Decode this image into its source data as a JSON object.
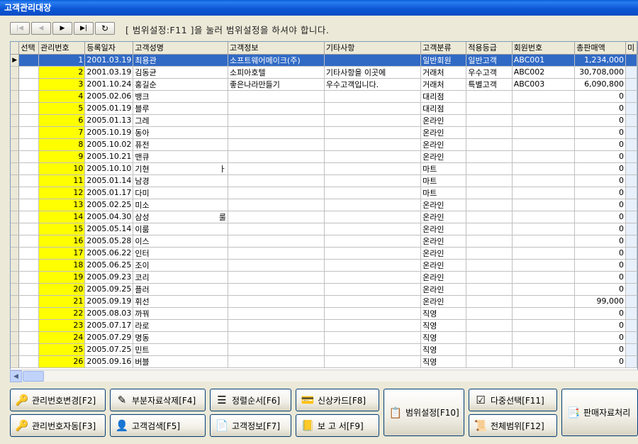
{
  "window": {
    "title": "고객관리대장"
  },
  "nav": {
    "first_icon": "first-record-icon",
    "prev_icon": "prev-record-icon",
    "next_icon": "next-record-icon",
    "last_icon": "last-record-icon",
    "refresh_icon": "refresh-icon",
    "hint": "[ 범위설정:F11 ]을 눌러 범위설정을 하셔야 합니다."
  },
  "grid": {
    "columns": [
      "선택",
      "관리번호",
      "등록일자",
      "고객성명",
      "고객정보",
      "기타사항",
      "고객분류",
      "적용등급",
      "회원번호",
      "총판매액",
      "미"
    ],
    "rows": [
      {
        "no": "1",
        "date": "2001.03.19",
        "name": "최용관",
        "info": "소프트웨어메이크(주)",
        "etc": "",
        "cat": "일반회원",
        "grade": "일반고객",
        "member": "ABC001",
        "total": "1,234,000"
      },
      {
        "no": "2",
        "date": "2001.03.19",
        "name": "김동균",
        "info": "소피아호텔",
        "etc": "기타사항을 이곳에",
        "cat": "거래처",
        "grade": "우수고객",
        "member": "ABC002",
        "total": "30,708,000"
      },
      {
        "no": "3",
        "date": "2001.10.24",
        "name": "홍길순",
        "info": "좋은나라만들기",
        "etc": "우수고객입니다.",
        "cat": "거래처",
        "grade": "특별고객",
        "member": "ABC003",
        "total": "6,090,800"
      },
      {
        "no": "4",
        "date": "2005.02.06",
        "name": "뱅크",
        "info": "",
        "etc": "",
        "cat": "대리점",
        "grade": "",
        "member": "",
        "total": "0"
      },
      {
        "no": "5",
        "date": "2005.01.19",
        "name": "블루",
        "info": "",
        "etc": "",
        "cat": "대리점",
        "grade": "",
        "member": "",
        "total": "0"
      },
      {
        "no": "6",
        "date": "2005.01.13",
        "name": "그레",
        "info": "",
        "etc": "",
        "cat": "온라인",
        "grade": "",
        "member": "",
        "total": "0"
      },
      {
        "no": "7",
        "date": "2005.10.19",
        "name": "동아",
        "info": "",
        "etc": "",
        "cat": "온라인",
        "grade": "",
        "member": "",
        "total": "0"
      },
      {
        "no": "8",
        "date": "2005.10.02",
        "name": "퓨전",
        "info": "",
        "etc": "",
        "cat": "온라인",
        "grade": "",
        "member": "",
        "total": "0"
      },
      {
        "no": "9",
        "date": "2005.10.21",
        "name": "맨큐",
        "info": "",
        "etc": "",
        "cat": "온라인",
        "grade": "",
        "member": "",
        "total": "0"
      },
      {
        "no": "10",
        "date": "2005.10.10",
        "name": "기현",
        "info": "",
        "etc": "",
        "cat": "마트",
        "grade": "",
        "member": "",
        "total": "0"
      },
      {
        "no": "11",
        "date": "2005.01.14",
        "name": "남경",
        "info": "",
        "etc": "",
        "cat": "마트",
        "grade": "",
        "member": "",
        "total": "0"
      },
      {
        "no": "12",
        "date": "2005.01.17",
        "name": "다미",
        "info": "",
        "etc": "",
        "cat": "마트",
        "grade": "",
        "member": "",
        "total": "0"
      },
      {
        "no": "13",
        "date": "2005.02.25",
        "name": "미소",
        "info": "",
        "etc": "",
        "cat": "온라인",
        "grade": "",
        "member": "",
        "total": "0"
      },
      {
        "no": "14",
        "date": "2005.04.30",
        "name": "삼성",
        "info": "",
        "etc": "",
        "cat": "온라인",
        "grade": "",
        "member": "",
        "total": "0"
      },
      {
        "no": "15",
        "date": "2005.05.14",
        "name": "이룸",
        "info": "",
        "etc": "",
        "cat": "온라인",
        "grade": "",
        "member": "",
        "total": "0"
      },
      {
        "no": "16",
        "date": "2005.05.28",
        "name": "이스",
        "info": "",
        "etc": "",
        "cat": "온라인",
        "grade": "",
        "member": "",
        "total": "0"
      },
      {
        "no": "17",
        "date": "2005.06.22",
        "name": "인터",
        "info": "",
        "etc": "",
        "cat": "온라인",
        "grade": "",
        "member": "",
        "total": "0"
      },
      {
        "no": "18",
        "date": "2005.06.25",
        "name": "조이",
        "info": "",
        "etc": "",
        "cat": "온라인",
        "grade": "",
        "member": "",
        "total": "0"
      },
      {
        "no": "19",
        "date": "2005.09.23",
        "name": "코리",
        "info": "",
        "etc": "",
        "cat": "온라인",
        "grade": "",
        "member": "",
        "total": "0"
      },
      {
        "no": "20",
        "date": "2005.09.25",
        "name": "플러",
        "info": "",
        "etc": "",
        "cat": "온라인",
        "grade": "",
        "member": "",
        "total": "0"
      },
      {
        "no": "21",
        "date": "2005.09.19",
        "name": "휘선",
        "info": "",
        "etc": "",
        "cat": "온라인",
        "grade": "",
        "member": "",
        "total": "99,000"
      },
      {
        "no": "22",
        "date": "2005.08.03",
        "name": "까꿔",
        "info": "",
        "etc": "",
        "cat": "직영",
        "grade": "",
        "member": "",
        "total": "0"
      },
      {
        "no": "23",
        "date": "2005.07.17",
        "name": "라로",
        "info": "",
        "etc": "",
        "cat": "직영",
        "grade": "",
        "member": "",
        "total": "0"
      },
      {
        "no": "24",
        "date": "2005.07.29",
        "name": "명동",
        "info": "",
        "etc": "",
        "cat": "직영",
        "grade": "",
        "member": "",
        "total": "0"
      },
      {
        "no": "25",
        "date": "2005.07.25",
        "name": "민트",
        "info": "",
        "etc": "",
        "cat": "직영",
        "grade": "",
        "member": "",
        "total": "0"
      },
      {
        "no": "26",
        "date": "2005.09.16",
        "name": "버블",
        "info": "",
        "etc": "",
        "cat": "직영",
        "grade": "",
        "member": "",
        "total": "0"
      }
    ],
    "name_overflow": {
      "10": "ㅏ",
      "14": "룰"
    }
  },
  "buttons": {
    "change_no": "관리번호변경[F2]",
    "auto_no": "관리번호자동[F3]",
    "partial_delete": "부분자료삭제[F4]",
    "search": "고객검색[F5]",
    "sort": "정렬순서[F6]",
    "info": "고객정보[F7]",
    "card": "신상카드[F8]",
    "report": "보 고 서[F9]",
    "range": "범위설정[F10]",
    "multi": "다중선택[F11]",
    "all_range": "전체범위[F12]",
    "sales": "판매자료처리"
  },
  "colors": {
    "selected_row": "#316ac5",
    "mgmt_no_bg": "#ffff00",
    "title_bar": "#0a4cc4"
  }
}
